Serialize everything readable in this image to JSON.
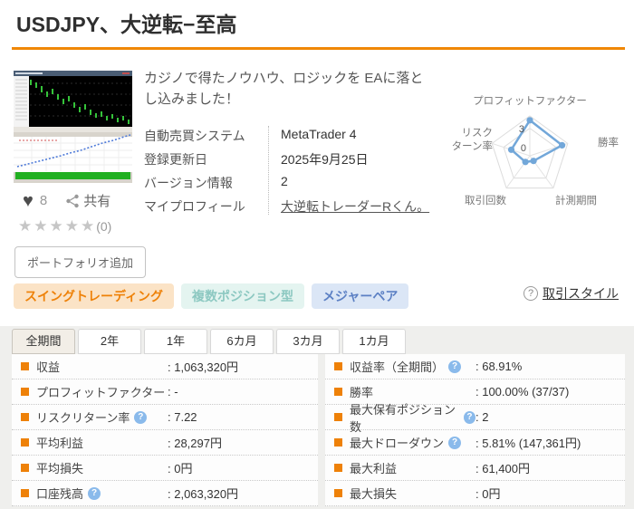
{
  "page": {
    "title": "USDJPY、大逆転−至高"
  },
  "icons": {
    "heart": "♥",
    "question": "?"
  },
  "product": {
    "description": "カジノで得たノウハウ、ロジックを EAに落とし込みました！",
    "details": [
      {
        "label": "自動売買システム",
        "value": "MetaTrader 4"
      },
      {
        "label": "登録更新日",
        "value": "2025年9月25日"
      },
      {
        "label": "バージョン情報",
        "value": "2"
      },
      {
        "label": "マイプロフィール",
        "value": "大逆転トレーダーRくん。"
      }
    ],
    "like_count": "8",
    "share_label": "共有",
    "stars": "★★★★★",
    "review_count": "(0)",
    "portfolio_button": "ポートフォリオ追加"
  },
  "tags": [
    {
      "label": "スイングトレーディング",
      "bg": "#fbe3c6",
      "color": "#ee8108"
    },
    {
      "label": "複数ポジション型",
      "bg": "#e4f4f0",
      "color": "#8cc8c1"
    },
    {
      "label": "メジャーペア",
      "bg": "#dbe6f6",
      "color": "#5c80c4"
    }
  ],
  "trade_style": {
    "label": "取引スタイル"
  },
  "tabs": [
    {
      "label": "全期間",
      "active": true
    },
    {
      "label": "2年",
      "active": false
    },
    {
      "label": "1年",
      "active": false
    },
    {
      "label": "6カ月",
      "active": false
    },
    {
      "label": "3カ月",
      "active": false
    },
    {
      "label": "1カ月",
      "active": false
    }
  ],
  "stats": {
    "left": [
      {
        "label": "収益",
        "value": ": 1,063,320円",
        "help": false
      },
      {
        "label": "プロフィットファクター",
        "value": ": -",
        "help": false
      },
      {
        "label": "リスクリターン率",
        "value": ": 7.22",
        "help": true
      },
      {
        "label": "平均利益",
        "value": ": 28,297円",
        "help": false
      },
      {
        "label": "平均損失",
        "value": ": 0円",
        "help": false
      },
      {
        "label": "口座残高",
        "value": ": 2,063,320円",
        "help": true
      }
    ],
    "right": [
      {
        "label": "収益率（全期間）",
        "value": ": 68.91%",
        "help": true
      },
      {
        "label": "勝率",
        "value": ": 100.00% (37/37)",
        "help": false
      },
      {
        "label": "最大保有ポジション数",
        "value": ": 2",
        "help": true
      },
      {
        "label": "最大ドローダウン",
        "value": ": 5.81% (147,361円)",
        "help": true
      },
      {
        "label": "最大利益",
        "value": ": 61,400円",
        "help": false
      },
      {
        "label": "最大損失",
        "value": ": 0円",
        "help": false
      }
    ]
  },
  "chart_data": {
    "type": "radar",
    "axes": [
      "プロフィットファクター",
      "勝率",
      "計測期間",
      "取引回数",
      "リスクターン率"
    ],
    "axis_display": {
      "top": "プロフィットファクター",
      "right": "勝率",
      "bottom_right": "計測期間",
      "bottom_left": "取引回数",
      "left_line1": "リスク",
      "left_line2": "ターン率"
    },
    "scale_labels": {
      "center": "0",
      "grid": "3"
    },
    "values_fraction_of_outer": [
      0.89,
      0.85,
      0.16,
      0.19,
      0.49
    ],
    "values_est": [
      3.9,
      3.7,
      0.7,
      0.8,
      2.1
    ],
    "line_color": "#72a7d9",
    "grid_color": "#dcdcdc",
    "legend": "none"
  },
  "colors": {
    "accent_orange": "#f08705",
    "bullet_orange": "#ee8108",
    "help_blue": "#8abaeb",
    "panel_gray": "#efefed"
  }
}
